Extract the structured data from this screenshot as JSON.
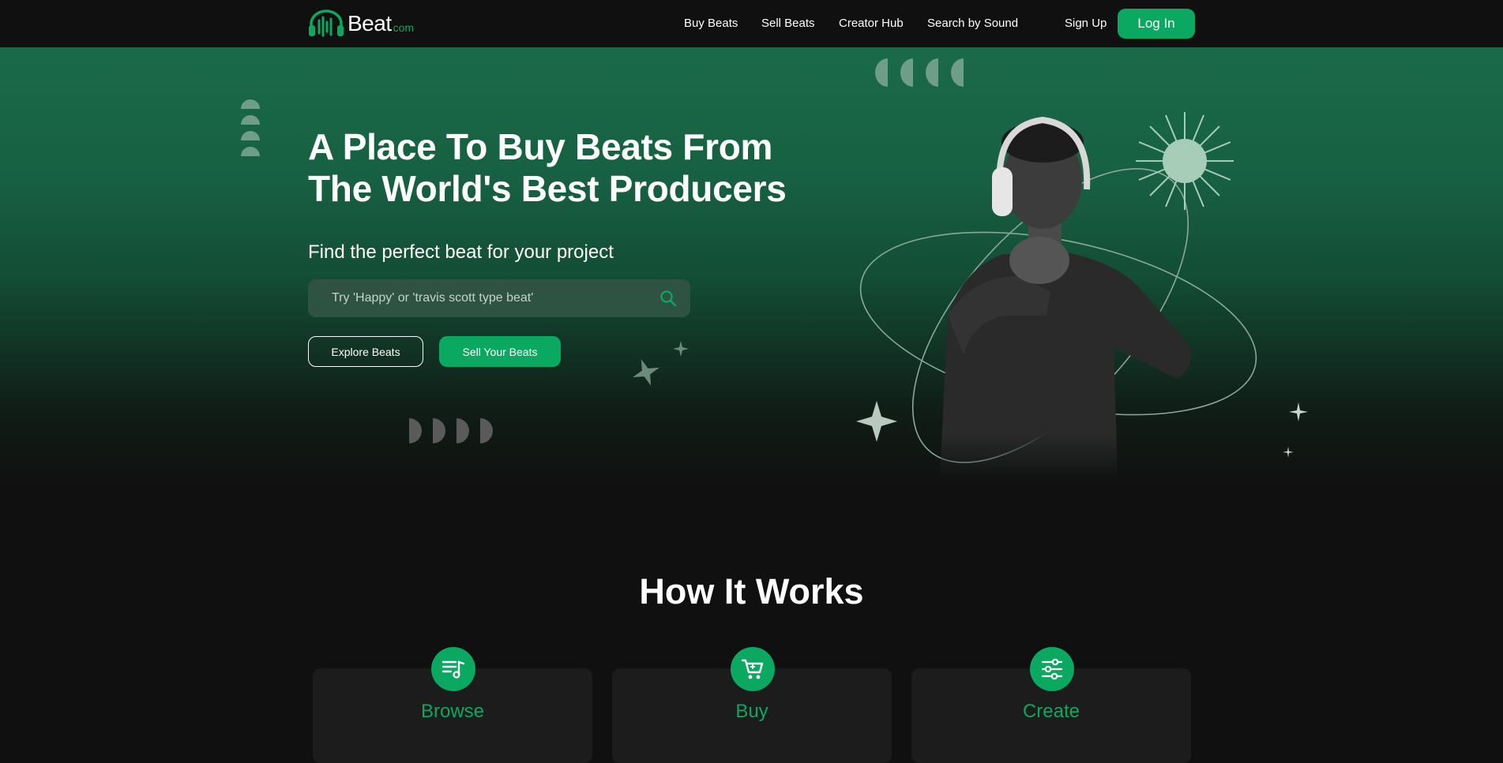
{
  "brand": {
    "name": "Beat",
    "tld": "com"
  },
  "nav": {
    "links": [
      "Buy Beats",
      "Sell Beats",
      "Creator Hub",
      "Search by Sound"
    ],
    "signup": "Sign Up",
    "login": "Log In"
  },
  "hero": {
    "title": "A Place To Buy Beats From The World's Best Producers",
    "subtitle": "Find the perfect beat for your project",
    "search_placeholder": "Try 'Happy' or 'travis scott type beat'",
    "explore_label": "Explore Beats",
    "sell_label": "Sell Your Beats"
  },
  "how": {
    "title": "How It Works",
    "steps": [
      {
        "label": "Browse",
        "icon": "playlist-icon"
      },
      {
        "label": "Buy",
        "icon": "cart-icon"
      },
      {
        "label": "Create",
        "icon": "sliders-icon"
      }
    ]
  },
  "colors": {
    "accent": "#0aa860",
    "background": "#101010",
    "hero_green": "#1a6a49",
    "card": "#1c1c1c"
  }
}
